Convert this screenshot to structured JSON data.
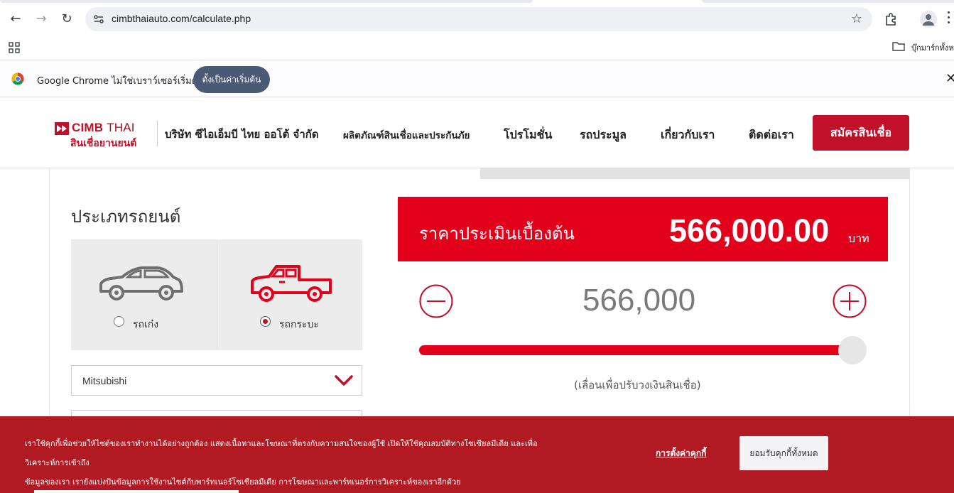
{
  "browser": {
    "url": "cimbthaiauto.com/calculate.php",
    "bookmarks_label": "บุ๊กมาร์กทั้งหมด",
    "infobar_text": "Google Chrome ไม่ใช่เบราว์เซอร์เริ่มต้น",
    "infobar_button": "ตั้งเป็นค่าเริ่มต้น",
    "infobar_close": "✕",
    "back_icon": "←",
    "forward_icon": "→",
    "reload_icon": "↻",
    "star_icon": "☆"
  },
  "header": {
    "logo_brand": "CIMB",
    "logo_brand_suffix": "THAI",
    "logo_sub": "สินเชื่อยานยนต์",
    "company": "บริษัท ซีไอเอ็มบี ไทย ออโต้ จำกัด",
    "nav": {
      "products": "ผลิตภัณฑ์สินเชื่อและประกันภัย",
      "promotions": "โปรโมชั่น",
      "auction": "รถประมูล",
      "about": "เกี่ยวกับเรา",
      "contact": "ติดต่อเรา"
    },
    "apply_button": "สมัครสินเชื่อ"
  },
  "calculator": {
    "car_type_title": "ประเภทรถยนต์",
    "car_types": [
      {
        "label": "รถเก๋ง",
        "selected": false,
        "icon": "sedan-icon"
      },
      {
        "label": "รถกระบะ",
        "selected": true,
        "icon": "pickup-icon"
      }
    ],
    "brand_selected": "Mitsubishi",
    "price_label": "ราคาประเมินเบื้องต้น",
    "price_value": "566,000.00",
    "price_unit": "บาท",
    "amount": "566,000",
    "slider_level_percent": 100,
    "slider_hint": "(เลื่อนเพื่อปรับวงเงินสินเชื่อ)"
  },
  "cookie": {
    "text_line1": "เราใช้คุกกี้เพื่อช่วยให้ไซต์ของเราทำงานได้อย่างถูกต้อง แสดงเนื้อหาและโฆษณาที่ตรงกับความสนใจของผู้ใช้ เปิดให้ใช้คุณสมบัติทางโซเชียลมีเดีย และเพื่อวิเคราะห์การเข้าถึง",
    "text_line2": "ข้อมูลของเรา เรายังแบ่งปันข้อมูลการใช้งานไซต์กับพาร์ทเนอร์โซเชียลมีเดีย การโฆษณาและพาร์ทเนอร์การวิเคราะห์ของเราอีกด้วย",
    "settings_link": "การตั้งค่าคุกกี้",
    "accept_button": "ยอมรับคุกกี้ทั้งหมด"
  },
  "colors": {
    "brand_red": "#c0102a",
    "banner_red": "#e3001b",
    "cookie_red": "#b11a22"
  }
}
